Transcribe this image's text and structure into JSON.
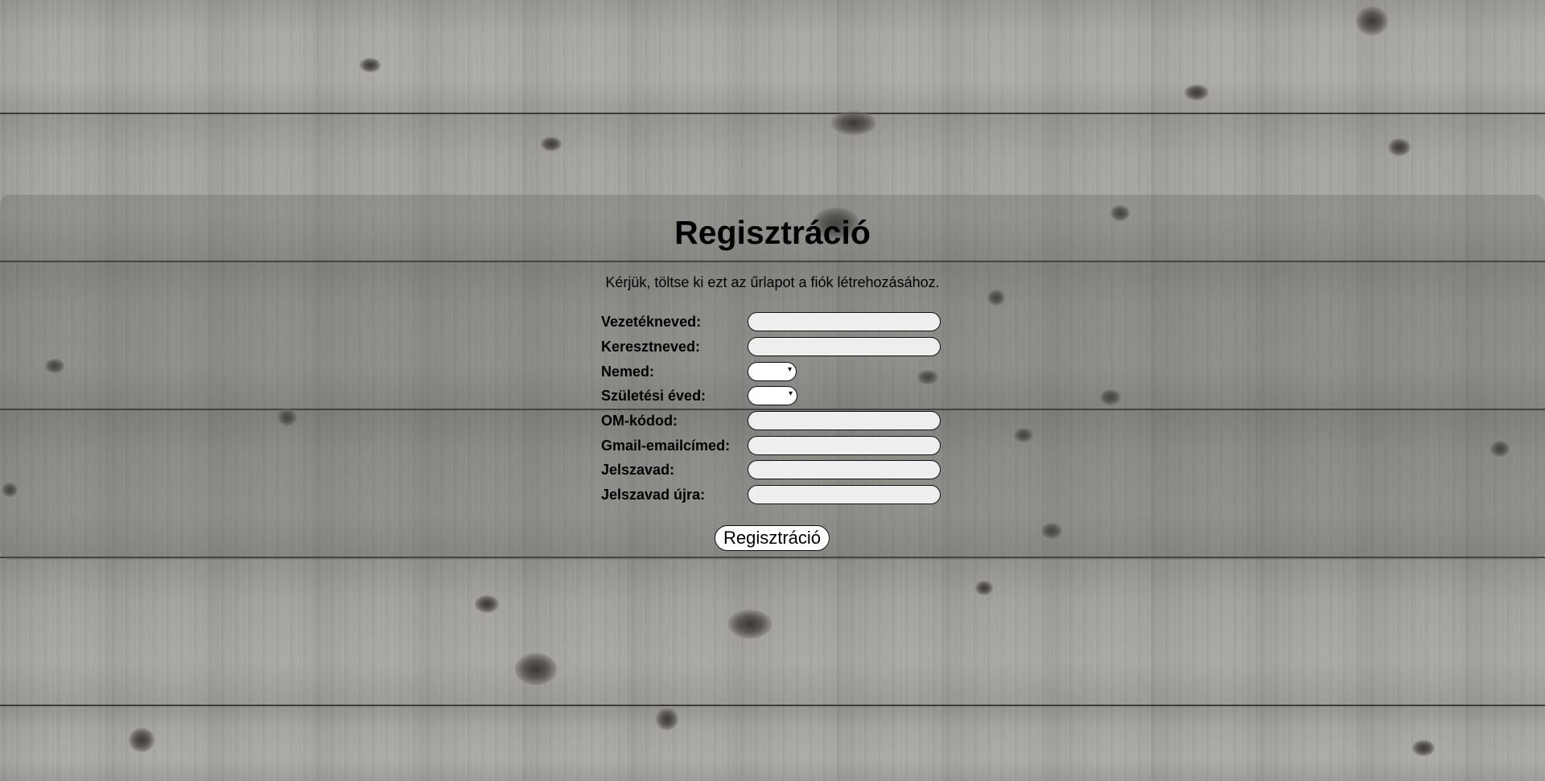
{
  "page": {
    "title": "Regisztráció",
    "subtitle": "Kérjük, töltse ki ezt az űrlapot a fiók létrehozásához."
  },
  "form": {
    "fields": [
      {
        "label": "Vezetékneved:",
        "type": "text",
        "value": ""
      },
      {
        "label": "Keresztneved:",
        "type": "text",
        "value": ""
      },
      {
        "label": "Nemed:",
        "type": "select",
        "value": ""
      },
      {
        "label": "Születési éved:",
        "type": "select",
        "value": ""
      },
      {
        "label": "OM-kódod:",
        "type": "text",
        "value": ""
      },
      {
        "label": "Gmail-emailcímed:",
        "type": "email",
        "value": ""
      },
      {
        "label": "Jelszavad:",
        "type": "password",
        "value": ""
      },
      {
        "label": "Jelszavad újra:",
        "type": "password",
        "value": ""
      }
    ],
    "submit_label": "Regisztráció",
    "dropdown_arrow": "▾"
  },
  "colors": {
    "input_bg": "#eeeeee",
    "input_border": "#111111",
    "text": "#000000"
  }
}
